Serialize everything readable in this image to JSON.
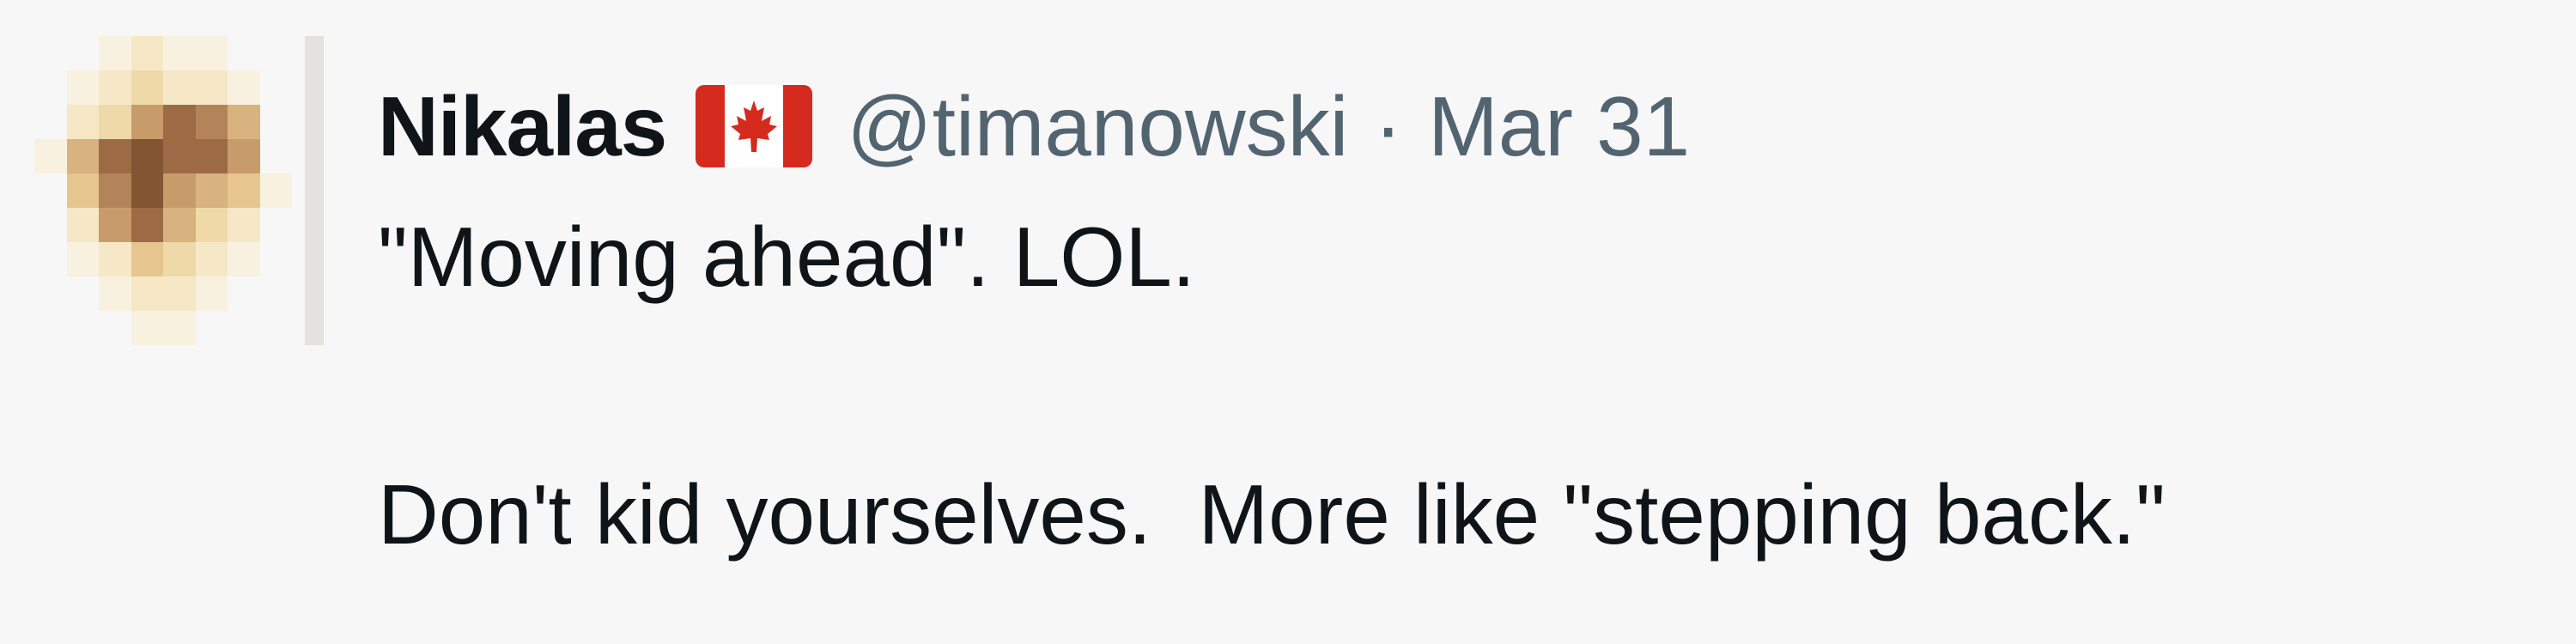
{
  "tweet": {
    "author": {
      "display_name": "Nikalas",
      "flag_icon": "canada-flag-icon",
      "handle": "@timanowski",
      "avatar_icon": "pixelated-avatar"
    },
    "separator": "·",
    "date": "Mar 31",
    "text_line_1": "\"Moving ahead\". LOL.",
    "text_line_2": "",
    "text_line_3": "Don't kid yourselves.  More like \"stepping back.\""
  },
  "colors": {
    "background": "#f7f7f7",
    "primary_text": "#0f1419",
    "secondary_text": "#536471",
    "flag_red": "#d52b1e",
    "flag_white": "#ffffff"
  }
}
